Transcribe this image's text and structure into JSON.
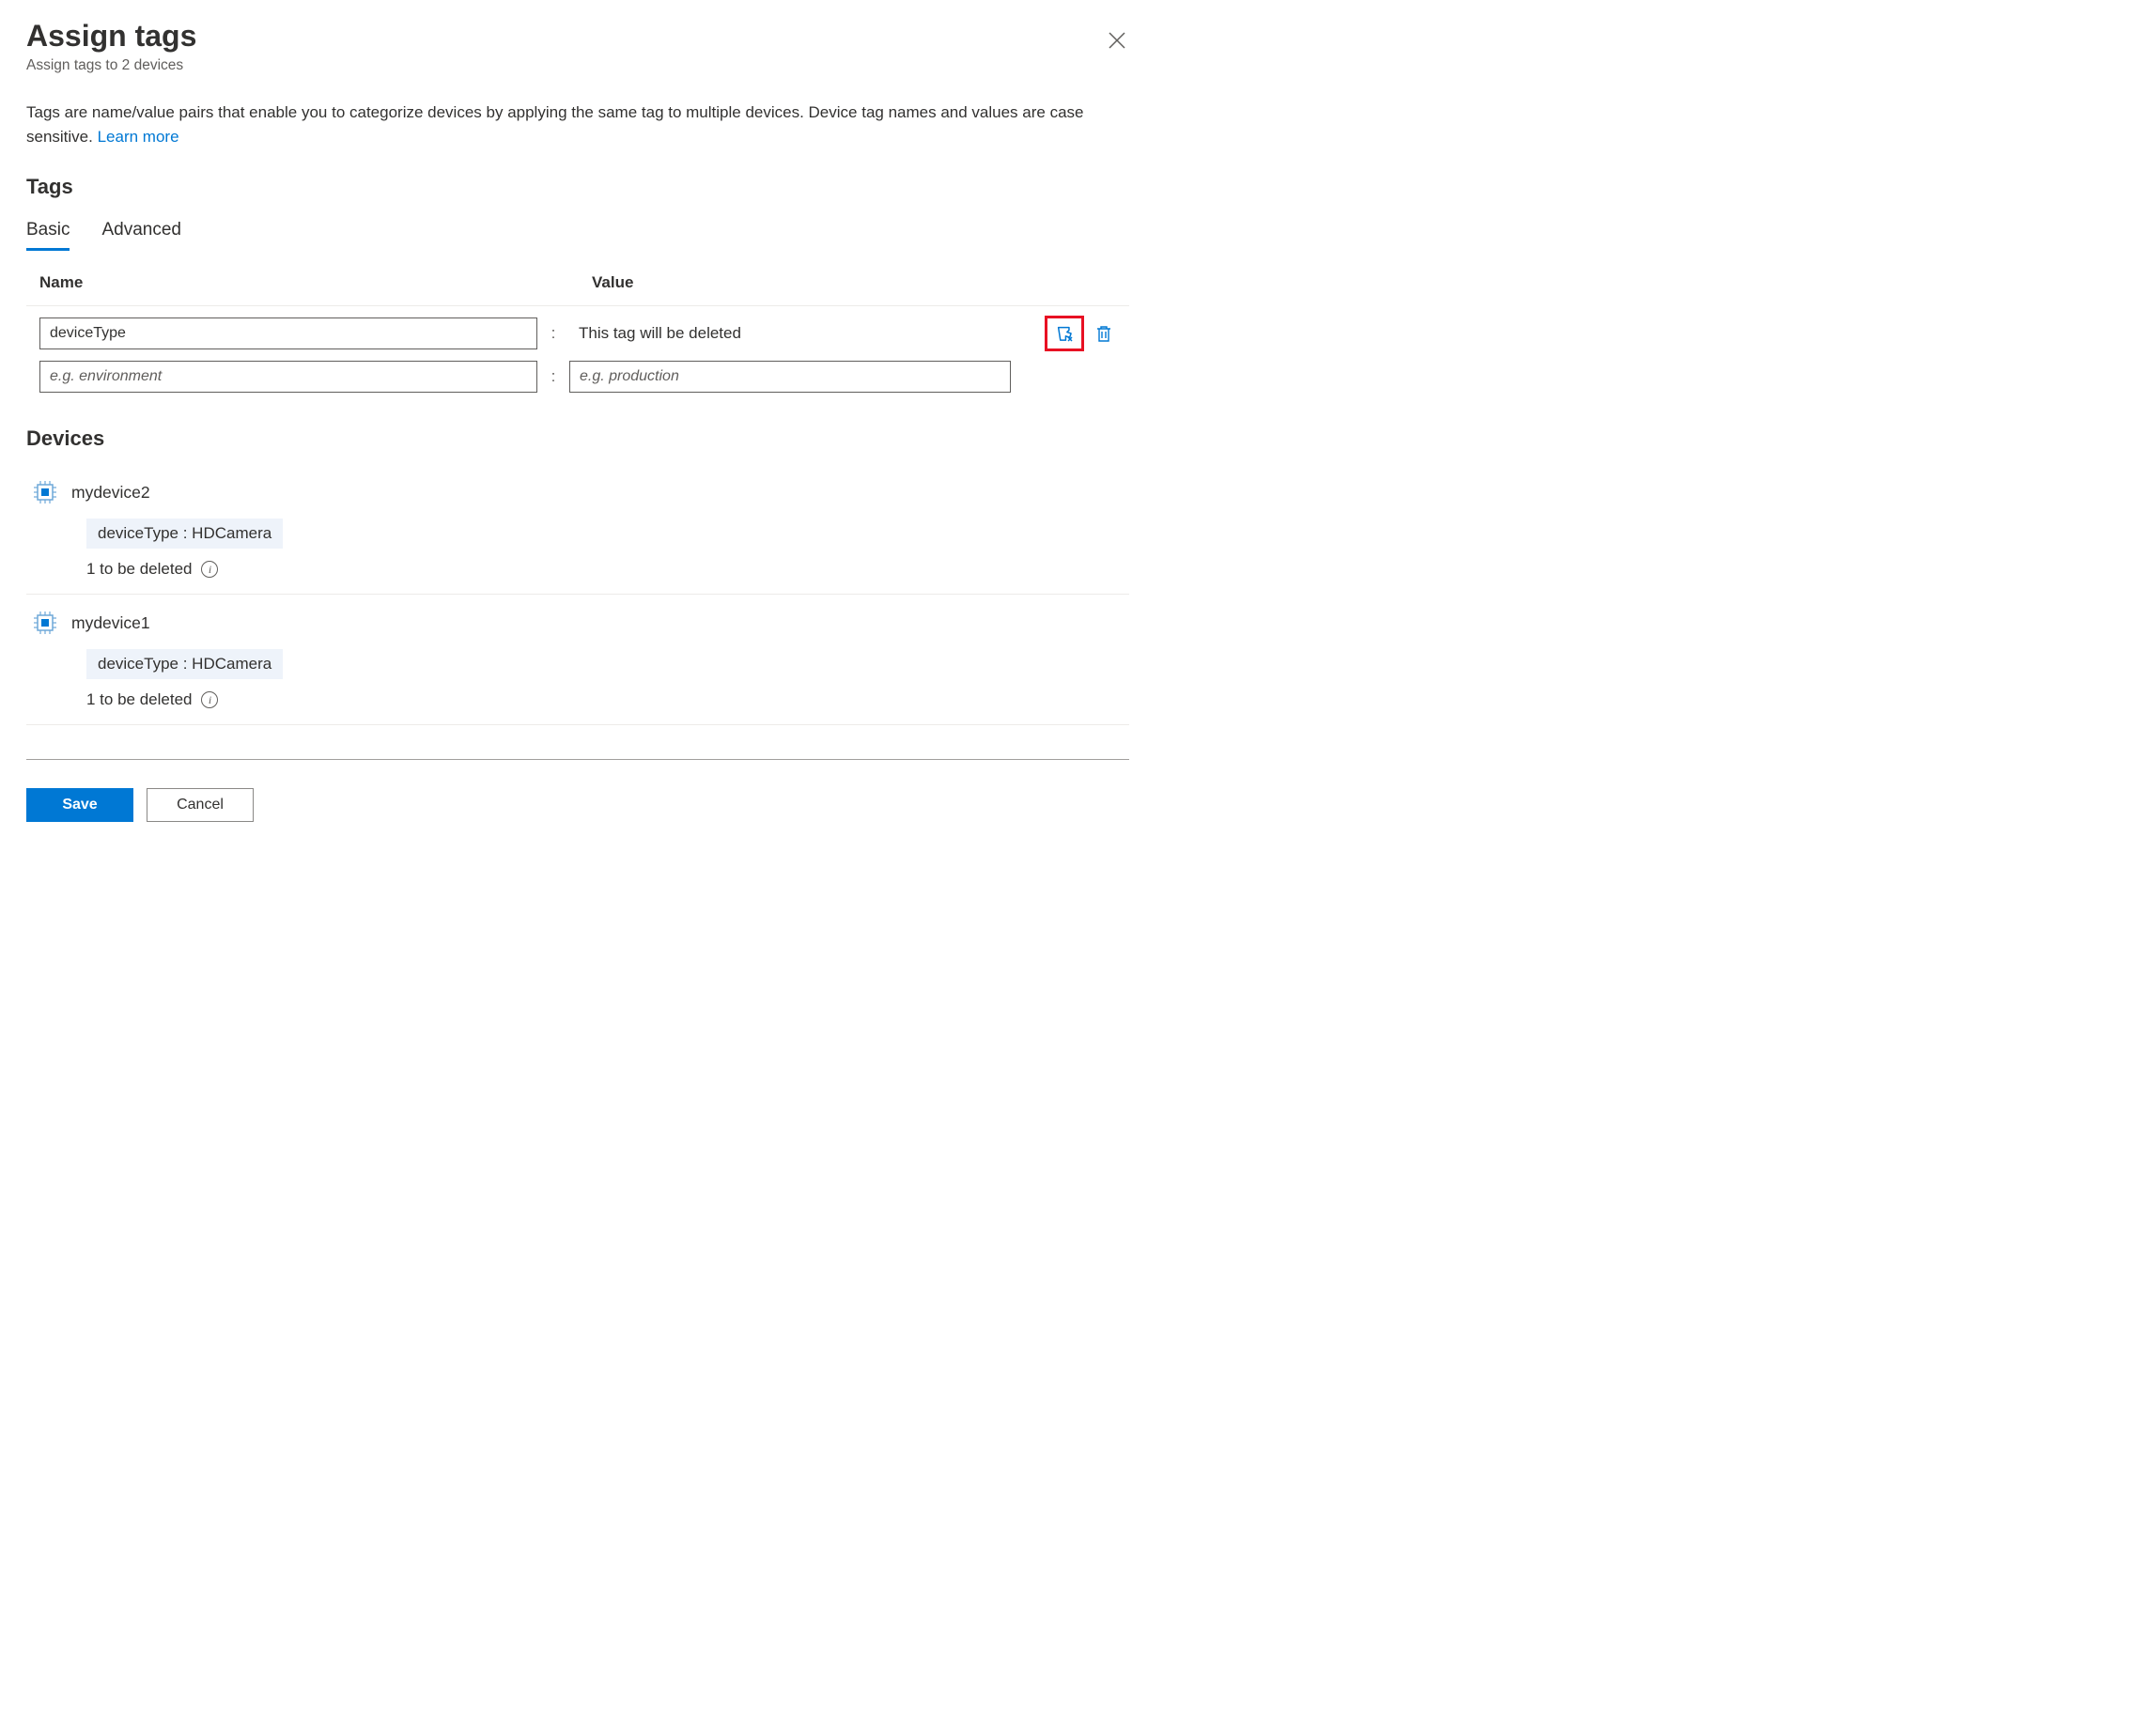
{
  "header": {
    "title": "Assign tags",
    "subtitle": "Assign tags to 2 devices"
  },
  "description": {
    "text": "Tags are name/value pairs that enable you to categorize devices by applying the same tag to multiple devices. Device tag names and values are case sensitive. ",
    "link": "Learn more"
  },
  "tags_section": {
    "heading": "Tags",
    "tabs": {
      "basic": "Basic",
      "advanced": "Advanced"
    },
    "columns": {
      "name": "Name",
      "value": "Value"
    },
    "row0": {
      "name": "deviceType",
      "value_text": "This tag will be deleted"
    },
    "row1": {
      "name_placeholder": "e.g. environment",
      "value_placeholder": "e.g. production"
    }
  },
  "devices_section": {
    "heading": "Devices",
    "items": [
      {
        "name": "mydevice2",
        "tag_label": "deviceType : HDCamera",
        "delete_note": "1 to be deleted"
      },
      {
        "name": "mydevice1",
        "tag_label": "deviceType : HDCamera",
        "delete_note": "1 to be deleted"
      }
    ]
  },
  "footer": {
    "save": "Save",
    "cancel": "Cancel"
  }
}
